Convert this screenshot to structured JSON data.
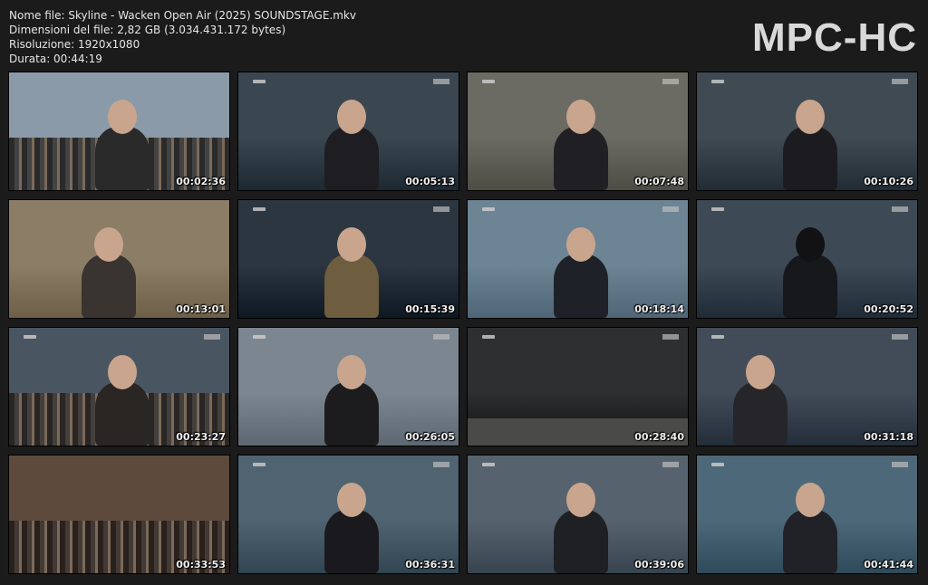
{
  "info": {
    "filename": "Nome file: Skyline - Wacken Open Air (2025) SOUNDSTAGE.mkv",
    "filesize": "Dimensioni del file: 2,82 GB (3.034.431.172 bytes)",
    "resolution": "Risoluzione: 1920x1080",
    "duration": "Durata: 00:44:19"
  },
  "logo": "MPC-HC",
  "thumbnails": [
    {
      "time": "00:02:36",
      "bg": "#8a9aa8",
      "fg": "#2a2a2a",
      "scene": "crowd-stage"
    },
    {
      "time": "00:05:13",
      "bg": "#3a4650",
      "fg": "#1e1e22",
      "scene": "singer"
    },
    {
      "time": "00:07:48",
      "bg": "#6b6b63",
      "fg": "#202024",
      "scene": "singer-mic"
    },
    {
      "time": "00:10:26",
      "bg": "#3f4a53",
      "fg": "#1c1c20",
      "scene": "singer"
    },
    {
      "time": "00:13:01",
      "bg": "#8c7d66",
      "fg": "#3a3430",
      "scene": "hug-mud"
    },
    {
      "time": "00:15:39",
      "bg": "#2c3640",
      "fg": "#6e5d3e",
      "scene": "drums"
    },
    {
      "time": "00:18:14",
      "bg": "#6d8494",
      "fg": "#1e2228",
      "scene": "singer"
    },
    {
      "time": "00:20:52",
      "bg": "#3d4a56",
      "fg": "#16181c",
      "scene": "singer-hair"
    },
    {
      "time": "00:23:27",
      "bg": "#4a5562",
      "fg": "#2a2624",
      "scene": "crowd-stage"
    },
    {
      "time": "00:26:05",
      "bg": "#7c8690",
      "fg": "#1c1c1e",
      "scene": "guitar"
    },
    {
      "time": "00:28:40",
      "bg": "#2e2f30",
      "fg": "#c8c6b8",
      "scene": "stage-wide"
    },
    {
      "time": "00:31:18",
      "bg": "#414c58",
      "fg": "#26262a",
      "scene": "singer-arm"
    },
    {
      "time": "00:33:53",
      "bg": "#5d4a3c",
      "fg": "#2a201c",
      "scene": "crowd"
    },
    {
      "time": "00:36:31",
      "bg": "#4f6370",
      "fg": "#1a1a1e",
      "scene": "singer"
    },
    {
      "time": "00:39:06",
      "bg": "#56636e",
      "fg": "#1e2024",
      "scene": "guitarist"
    },
    {
      "time": "00:41:44",
      "bg": "#4d6878",
      "fg": "#202228",
      "scene": "singer-mic"
    }
  ]
}
